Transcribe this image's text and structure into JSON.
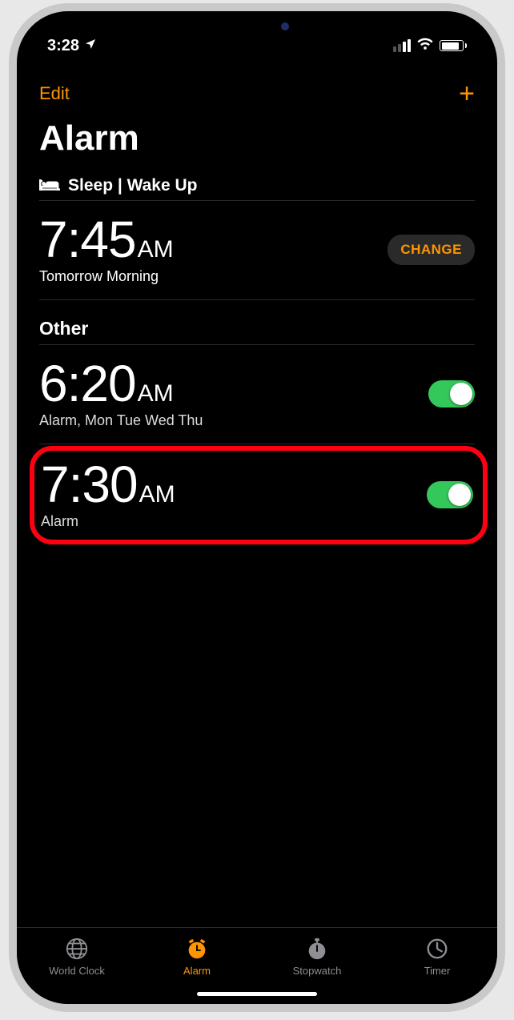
{
  "status": {
    "time": "3:28"
  },
  "nav": {
    "edit_label": "Edit"
  },
  "page": {
    "title": "Alarm"
  },
  "sleep": {
    "section_label": "Sleep | Wake Up",
    "time": "7:45",
    "ampm": "AM",
    "subtitle": "Tomorrow Morning",
    "change_label": "CHANGE"
  },
  "other": {
    "section_label": "Other",
    "alarms": [
      {
        "time": "6:20",
        "ampm": "AM",
        "label": "Alarm, Mon Tue Wed Thu",
        "enabled": true
      },
      {
        "time": "7:30",
        "ampm": "AM",
        "label": "Alarm",
        "enabled": true
      }
    ]
  },
  "tabs": {
    "world_clock": "World Clock",
    "alarm": "Alarm",
    "stopwatch": "Stopwatch",
    "timer": "Timer"
  }
}
